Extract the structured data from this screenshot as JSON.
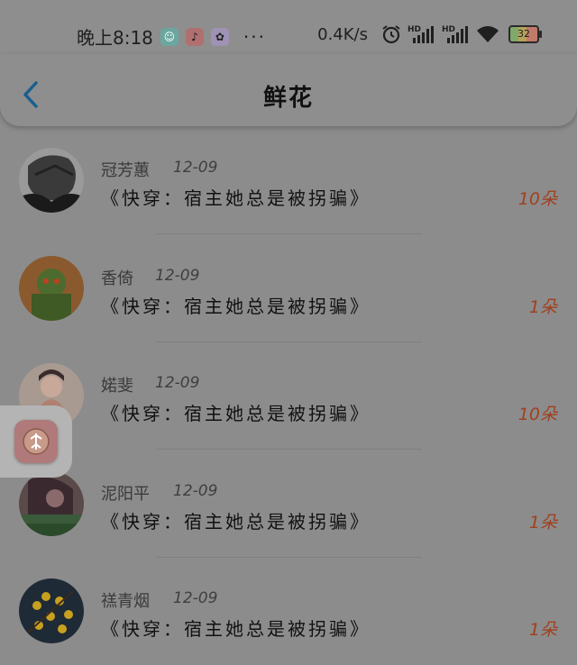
{
  "status_bar": {
    "time": "晚上8:18",
    "dots": "···",
    "net_speed": "0.4K/s",
    "battery": "32",
    "icons": [
      "app-icon-1",
      "tiktok-icon",
      "app-icon-3",
      "alarm-icon",
      "hd-signal-icon",
      "hd-signal-icon",
      "wifi-icon",
      "battery-icon"
    ]
  },
  "header": {
    "title": "鲜花"
  },
  "items": [
    {
      "user": "冠芳蕙",
      "date": "12-09",
      "book": "《快穿：宿主她总是被拐骗》",
      "flowers": "10朵"
    },
    {
      "user": "香倚",
      "date": "12-09",
      "book": "《快穿：宿主她总是被拐骗》",
      "flowers": "1朵"
    },
    {
      "user": "婼斐",
      "date": "12-09",
      "book": "《快穿：宿主她总是被拐骗》",
      "flowers": "10朵"
    },
    {
      "user": "泥阳平",
      "date": "12-09",
      "book": "《快穿：宿主她总是被拐骗》",
      "flowers": "1朵"
    },
    {
      "user": "禚青烟",
      "date": "12-09",
      "book": "《快穿：宿主她总是被拐骗》",
      "flowers": "1朵"
    }
  ],
  "colors": {
    "accent": "#1a5f8f",
    "flower_count": "#a0401f",
    "overlay_background": "#8c8c8c"
  }
}
